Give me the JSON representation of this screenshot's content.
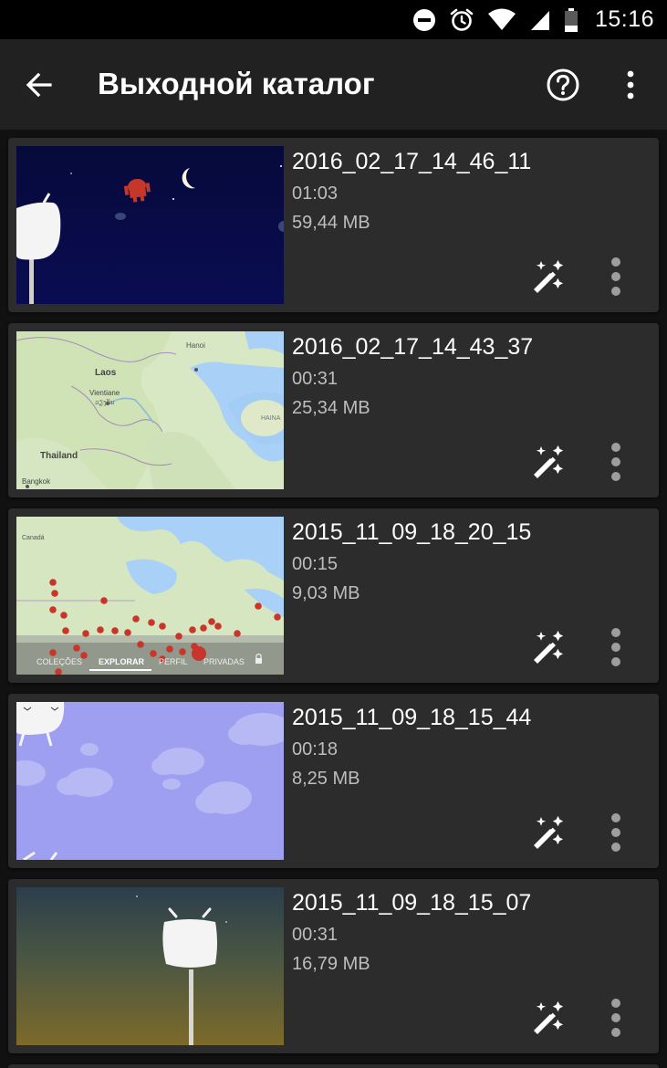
{
  "status_bar": {
    "time": "15:16",
    "icons": [
      "do-not-disturb-icon",
      "alarm-icon",
      "wifi-icon",
      "cell-signal-icon",
      "battery-icon"
    ]
  },
  "app_bar": {
    "title": "Выходной каталог",
    "icons": [
      "back-arrow-icon",
      "help-icon",
      "more-vert-icon"
    ]
  },
  "recordings": [
    {
      "name": "2016_02_17_14_46_11",
      "duration": "01:03",
      "size": "59,44 MB",
      "thumbnail": "night-sky-marshmallow"
    },
    {
      "name": "2016_02_17_14_43_37",
      "duration": "00:31",
      "size": "25,34 MB",
      "thumbnail": "map-laos-thailand",
      "thumb_labels": {
        "hanoi": "Hanoi",
        "laos": "Laos",
        "vientiane": "Vientiane",
        "vientiane_local": "ວຽງຈັນ",
        "hainan": "HAINA",
        "thailand": "Thailand",
        "bangkok": "Bangkok"
      }
    },
    {
      "name": "2015_11_09_18_20_15",
      "duration": "00:15",
      "size": "9,03 MB",
      "thumbnail": "map-north-america",
      "thumb_labels": {
        "canada": "Canadá",
        "tab1": "COLEÇÕES",
        "tab2": "EXPLORAR",
        "tab3": "PERFIL",
        "tab4": "PRIVADAS"
      }
    },
    {
      "name": "2015_11_09_18_15_44",
      "duration": "00:18",
      "size": "8,25 MB",
      "thumbnail": "purple-sky-clouds"
    },
    {
      "name": "2015_11_09_18_15_07",
      "duration": "00:31",
      "size": "16,79 MB",
      "thumbnail": "dusk-marshmallow"
    }
  ],
  "card_actions": {
    "edit_icon": "magic-wand-icon",
    "more_icon": "more-vert-icon"
  },
  "colors": {
    "status_bar": "#000000",
    "app_bar": "#212121",
    "card": "#2c2c2c",
    "background": "#111111",
    "secondary_text": "#bdbdbd"
  }
}
